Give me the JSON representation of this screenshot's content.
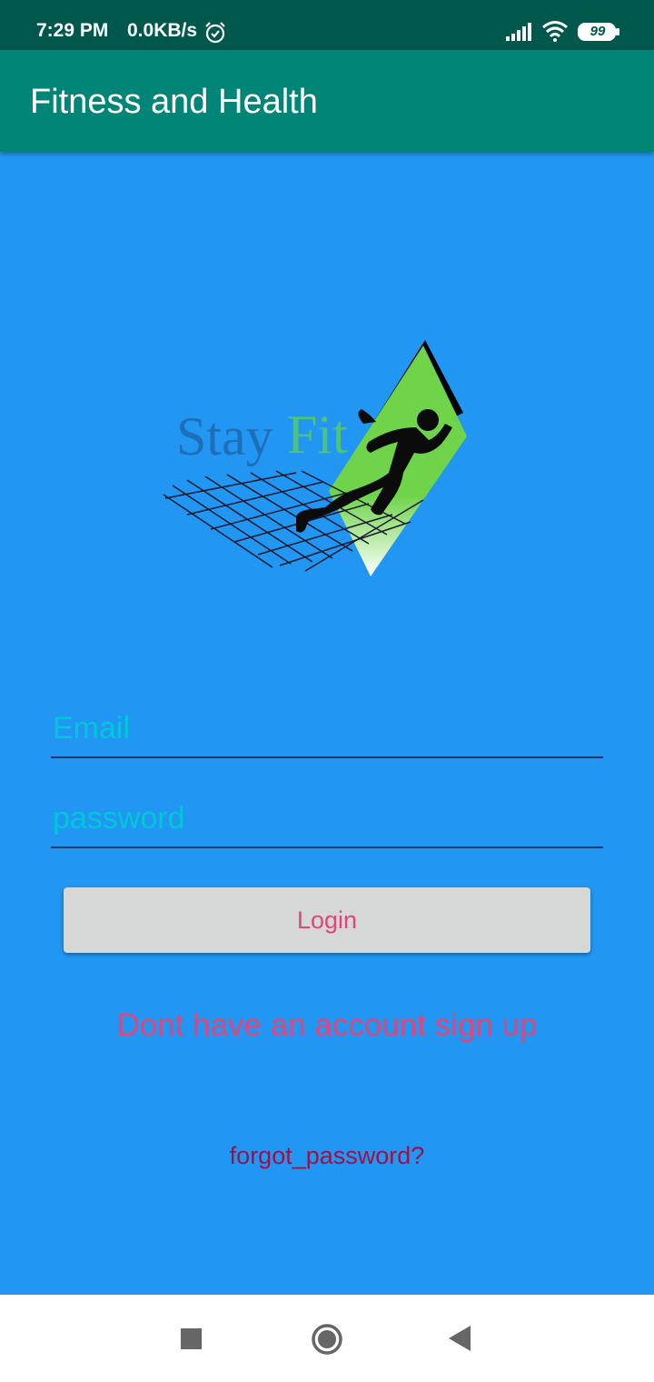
{
  "status_bar": {
    "time": "7:29 PM",
    "speed": "0.0KB/s",
    "battery": "99",
    "icons": [
      "alarm-icon",
      "signal-icon",
      "wifi-icon",
      "battery-icon"
    ]
  },
  "app_bar": {
    "title": "Fitness and Health"
  },
  "logo": {
    "text": "Stay Fit",
    "colors": {
      "text_blue": "#1F6FB8",
      "text_green": "#4FC37A",
      "diamond": "#6FD44A"
    }
  },
  "form": {
    "email_placeholder": "Email",
    "password_placeholder": "password",
    "login_label": "Login",
    "signup_label": "Dont have an account sign up",
    "forgot_label": "forgot_password?"
  },
  "nav_bar": {
    "icons": [
      "recents-square-icon",
      "home-circle-icon",
      "back-triangle-icon"
    ]
  },
  "colors": {
    "status_bar": "#00574B",
    "app_bar": "#008577",
    "background": "#2196F3",
    "accent_text": "#E0457B",
    "forgot_text": "#A01048",
    "input_text": "#00C8D8"
  }
}
